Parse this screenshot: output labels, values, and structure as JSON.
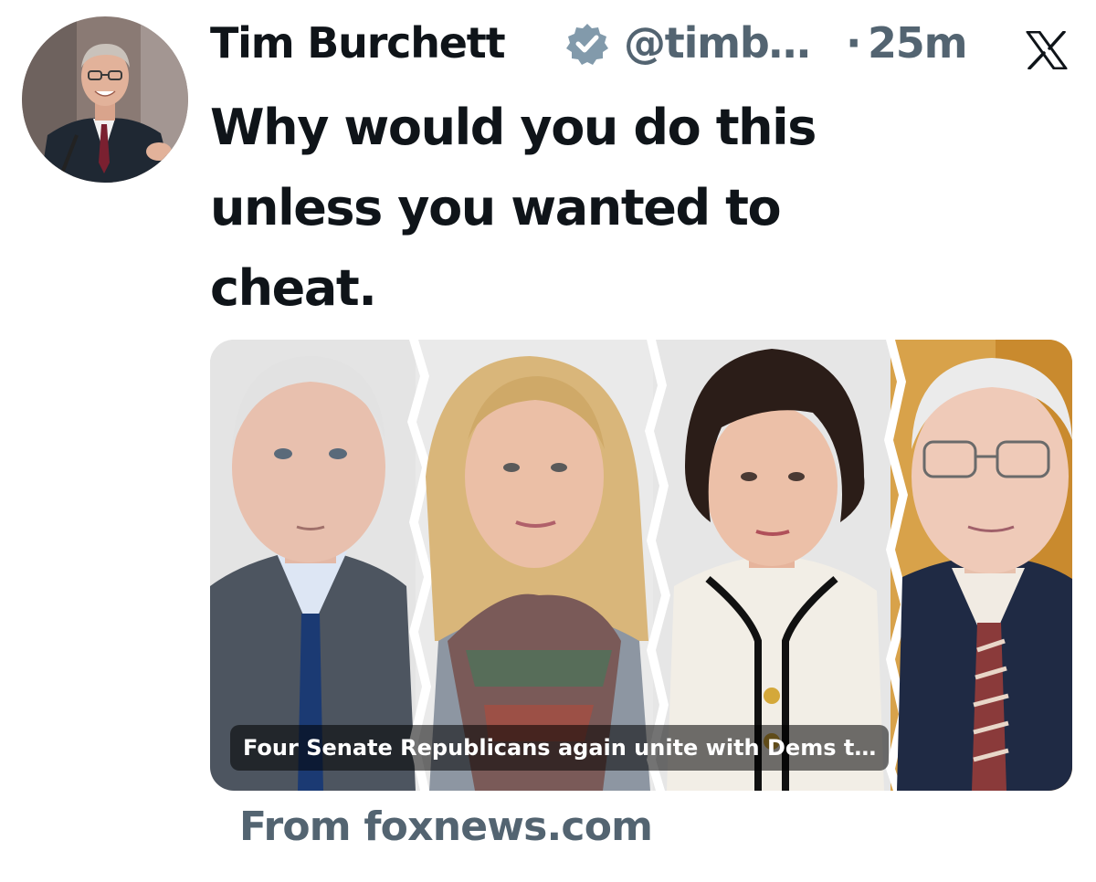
{
  "author": {
    "display_name": "Tim Burchett",
    "handle": "@timb…",
    "separator": "·",
    "time_ago": "25m",
    "verified_badge_icon": "verified-badge-icon",
    "badge_color": "#829aab"
  },
  "platform": {
    "logo_icon": "x-logo-icon"
  },
  "tweet": {
    "text": "Why would you do this\nunless you wanted  to\ncheat."
  },
  "link_card": {
    "caption": "Four Senate Republicans again unite with Dems t…",
    "source": "From foxnews.com"
  },
  "colors": {
    "text_primary": "#0f1419",
    "text_secondary": "#536471"
  }
}
